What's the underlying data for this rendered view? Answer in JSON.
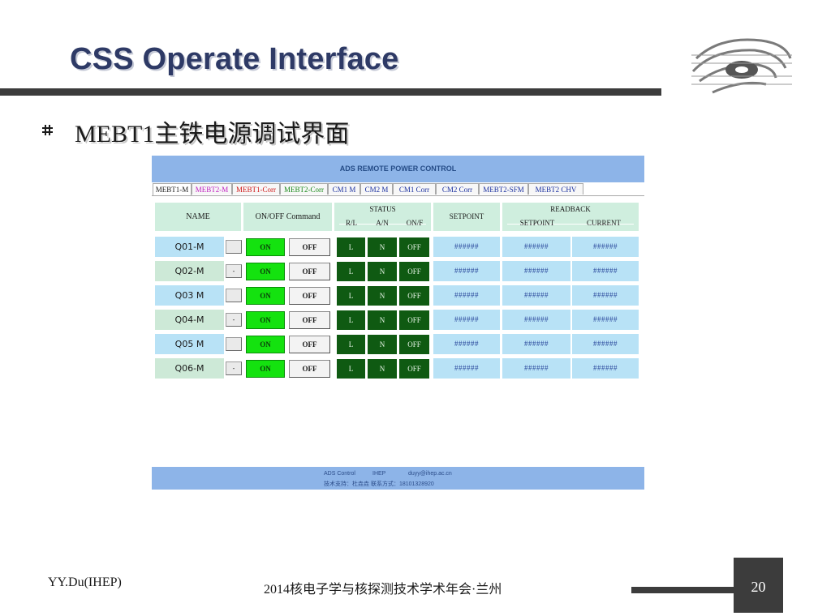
{
  "slide": {
    "title": "CSS Operate Interface",
    "heading": "MEBT1主铁电源调试界面",
    "footer_left": "YY.Du(IHEP)",
    "footer_center": "2014核电子学与核探测技术学术年会·兰州",
    "page_number": "20"
  },
  "app": {
    "title": "ADS REMOTE POWER CONTROL",
    "tabs": [
      {
        "label": "MEBT1-M",
        "color": "#1a1a1a",
        "active": true
      },
      {
        "label": "MEBT2-M",
        "color": "#c020c0"
      },
      {
        "label": "MEBT1-Corr",
        "color": "#d01818"
      },
      {
        "label": "MEBT2-Corr",
        "color": "#1a8a1a"
      },
      {
        "label": "CM1 M",
        "color": "#1a30a0"
      },
      {
        "label": "CM2 M",
        "color": "#1a30a0"
      },
      {
        "label": "CM1 Corr",
        "color": "#1a30a0"
      },
      {
        "label": "CM2 Corr",
        "color": "#1a30a0"
      },
      {
        "label": "MEBT2-SFM",
        "color": "#1a30a0"
      },
      {
        "label": "MEBT2 CHV",
        "color": "#1a30a0"
      }
    ],
    "headers": {
      "name": "NAME",
      "command": "ON/OFF Command",
      "status": "STATUS",
      "status_rl": "R/L",
      "status_an": "A/N",
      "status_onf": "ON/F",
      "setpoint": "SETPOINT",
      "readback": "READBACK",
      "rb_setpoint": "SETPOINT",
      "rb_current": "CURRENT"
    },
    "rows": [
      {
        "name": "Q01-M",
        "btn": "",
        "on": "ON",
        "off": "OFF",
        "rl": "L",
        "an": "N",
        "onf": "OFF",
        "setpoint": "######",
        "rb_setpoint": "######",
        "rb_current": "######"
      },
      {
        "name": "Q02-M",
        "btn": "-",
        "on": "ON",
        "off": "OFF",
        "rl": "L",
        "an": "N",
        "onf": "OFF",
        "setpoint": "######",
        "rb_setpoint": "######",
        "rb_current": "######"
      },
      {
        "name": "Q03 M",
        "btn": "",
        "on": "ON",
        "off": "OFF",
        "rl": "L",
        "an": "N",
        "onf": "OFF",
        "setpoint": "######",
        "rb_setpoint": "######",
        "rb_current": "######"
      },
      {
        "name": "Q04-M",
        "btn": "-",
        "on": "ON",
        "off": "OFF",
        "rl": "L",
        "an": "N",
        "onf": "OFF",
        "setpoint": "######",
        "rb_setpoint": "######",
        "rb_current": "######"
      },
      {
        "name": "Q05 M",
        "btn": "",
        "on": "ON",
        "off": "OFF",
        "rl": "L",
        "an": "N",
        "onf": "OFF",
        "setpoint": "######",
        "rb_setpoint": "######",
        "rb_current": "######"
      },
      {
        "name": "Q06-M",
        "btn": "-",
        "on": "ON",
        "off": "OFF",
        "rl": "L",
        "an": "N",
        "onf": "OFF",
        "setpoint": "######",
        "rb_setpoint": "######",
        "rb_current": "######"
      }
    ],
    "footer": {
      "line1_a": "ADS Control",
      "line1_b": "IHEP",
      "line1_c": "duyy@ihep.ac.cn",
      "line2": "技术支持：杜垚垚 联系方式：18101328920"
    }
  },
  "colors": {
    "title_text": "#2e3a66",
    "app_header": "#8db4e8",
    "on_button": "#14e20f",
    "status_fill": "#0f5a12",
    "row_blue": "#b8e2f6",
    "row_green": "#cde9d7"
  },
  "icons": {
    "logo": "ihep-swirl-logo",
    "bullet": "hash-bullet-icon"
  }
}
